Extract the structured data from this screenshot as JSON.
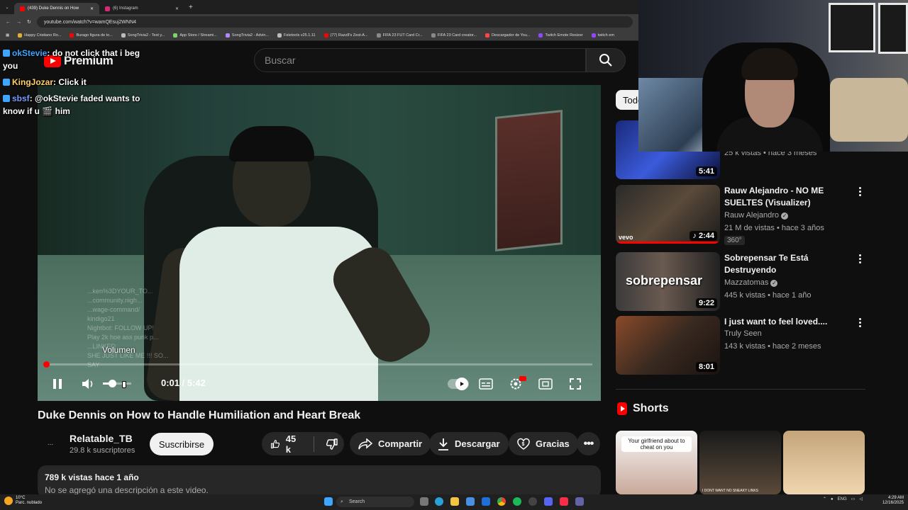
{
  "browser": {
    "tabs": [
      {
        "label": "(439) Duke Dennis on How",
        "color": "#ff0000"
      },
      {
        "label": "(6) Instagram",
        "color": "#d62976"
      }
    ],
    "new_tab": "+",
    "url": "youtube.com/watch?v=wamQEsuj2WNN4",
    "bookmarks": [
      {
        "label": "Happy Cristiano Ro...",
        "color": "#e0b030"
      },
      {
        "label": "Burago figura de to...",
        "color": "#ff0000"
      },
      {
        "label": "SongTrivia2 - Test y...",
        "color": "#bbbbbb"
      },
      {
        "label": "App Store / Streami...",
        "color": "#7fd36b"
      },
      {
        "label": "SongTrivia2 - Advin...",
        "color": "#b388ff"
      },
      {
        "label": "Feletools v25.1.11",
        "color": "#bbbbbb"
      },
      {
        "label": "(77) Razz8's Zest-A...",
        "color": "#ff0000"
      },
      {
        "label": "FIFA 23 FUT Card Cr...",
        "color": "#888888"
      },
      {
        "label": "FIFA 23 Card creator...",
        "color": "#888888"
      },
      {
        "label": "Descargador de You...",
        "color": "#ff4444"
      },
      {
        "label": "Twitch Emote Resizer",
        "color": "#9146ff"
      },
      {
        "label": "twitch em",
        "color": "#9146ff"
      }
    ]
  },
  "header": {
    "logo_text": "Premium",
    "search_placeholder": "Buscar"
  },
  "chat": [
    {
      "user": "okStevie",
      "message": ": do not click that i beg you"
    },
    {
      "user": "KingJozar",
      "message": ": Click it"
    },
    {
      "user": "sbsf",
      "message": ": @okStevie faded wants to know if u",
      "message_end": "him"
    }
  ],
  "player": {
    "volume_tooltip": "Volumen",
    "time": "0:01 / 5:42",
    "progress_fraction": 0.002,
    "volume_fraction": 0.35,
    "overlay_lines": [
      "...ken%3DYOUR_TO...",
      "...community.nigh...",
      "...wage-command/",
      "kindigo21",
      "Nightbot: FOLLOW UP!",
      "Play 2k hoe ass punk p...",
      "...LINKED",
      "SHE JUST LIKE ME !!! SO...",
      "SAY"
    ]
  },
  "video": {
    "title": "Duke Dennis on How to Handle Humiliation and Heart Break",
    "channel": "Relatable_TB",
    "avatar": "...",
    "subscribers": "29.8 k suscriptores",
    "subscribe": "Suscribirse",
    "likes": "45 k",
    "share": "Compartir",
    "download": "Descargar",
    "thanks": "Gracias",
    "views_date": "789 k vistas  hace 1 año",
    "description": "No se agregó una descripción a este video."
  },
  "sidebar": {
    "chip": "Todos",
    "recs": [
      {
        "title": "",
        "channel": "",
        "meta": "25 k vistas • hace 3 meses",
        "duration": "5:41"
      },
      {
        "title": "Rauw Alejandro - NO ME SUELTES (Visualizer)",
        "channel": "Rauw Alejandro",
        "meta": "21 M de vistas • hace 3 años",
        "duration": "2:44",
        "tag": "360°",
        "thumb_text": "vevo"
      },
      {
        "title": "Sobrepensar Te Está Destruyendo",
        "channel": "Mazzatomas",
        "meta": "445 k vistas • hace 1 año",
        "duration": "9:22",
        "thumb_text": "sobrepensar"
      },
      {
        "title": "I just want to feel loved....",
        "channel": "Truly Seen",
        "meta": "143 k vistas • hace 2 meses",
        "duration": "8:01"
      }
    ],
    "shorts_title": "Shorts",
    "shorts": [
      {
        "caption": "Your girlfriend about to cheat on you"
      },
      {
        "caption": "I DONT WANT NO SNEAKY LINKS"
      },
      {
        "caption": ""
      }
    ]
  },
  "taskbar": {
    "weather_temp": "10°C",
    "weather_desc": "Parc. nublado",
    "search": "Search",
    "lang": "ENG",
    "time": "4:29 AM",
    "date": "12/16/2025"
  }
}
